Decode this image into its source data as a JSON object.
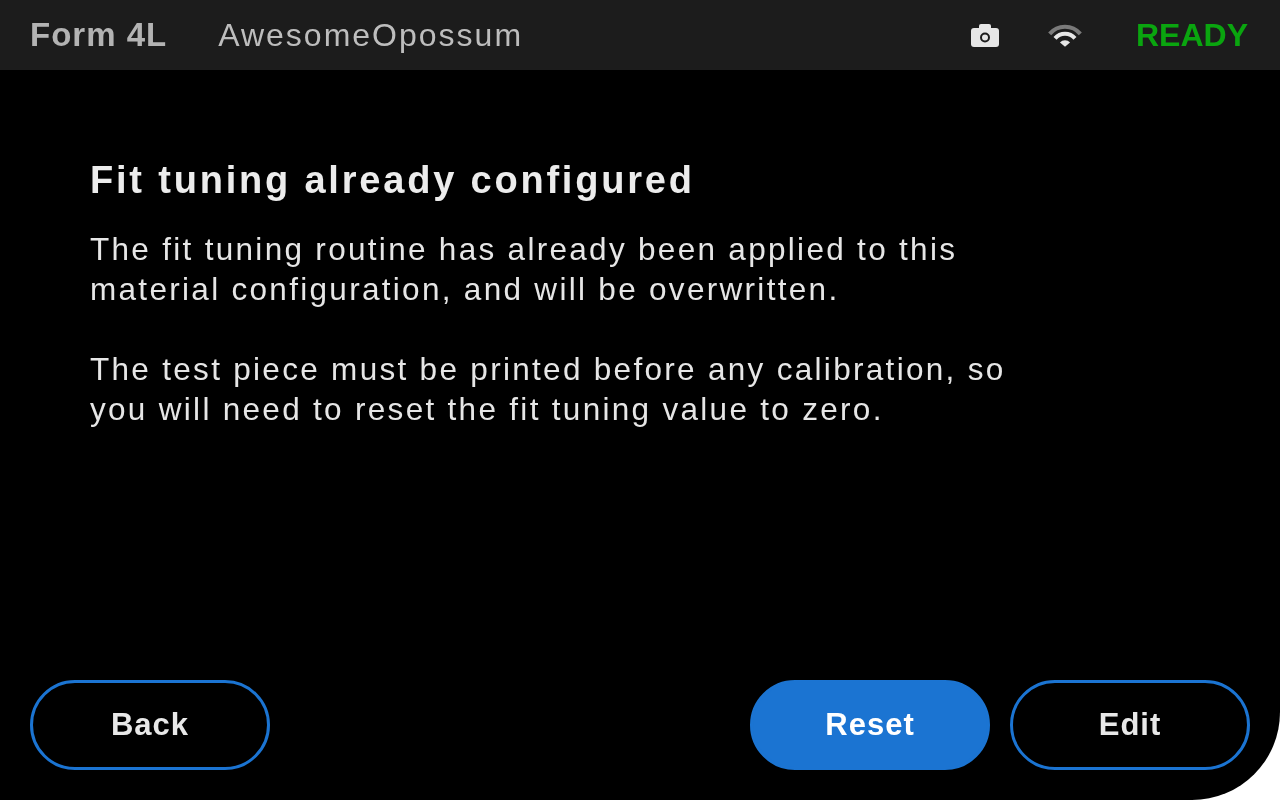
{
  "top_bar": {
    "printer_model": "Form 4L",
    "printer_name": "AwesomeOpossum",
    "status": "READY"
  },
  "dialog": {
    "title": "Fit tuning already configured",
    "paragraphs": [
      "The fit tuning routine has already been applied to this material configuration, and will be overwritten.",
      "The test piece must be printed before any calibration, so you will need to reset the fit tuning value to zero."
    ]
  },
  "footer": {
    "left_buttons": [
      {
        "label": "Back",
        "kind": "outline"
      }
    ],
    "right_buttons": [
      {
        "label": "Reset",
        "kind": "primary"
      },
      {
        "label": "Edit",
        "kind": "outline"
      }
    ]
  }
}
